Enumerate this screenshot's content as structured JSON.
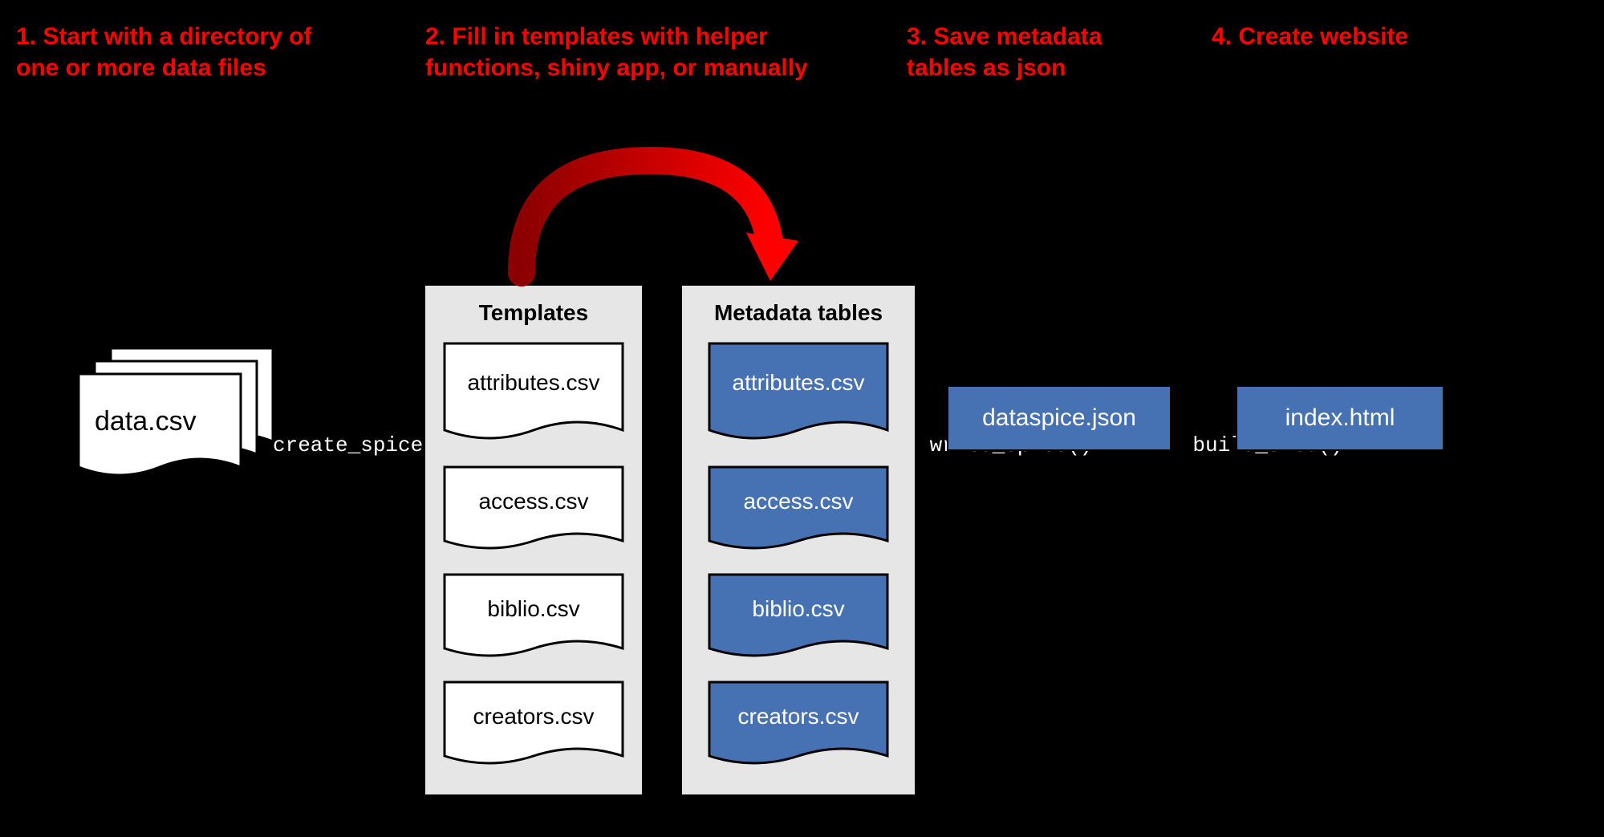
{
  "steps": {
    "s1": "1. Start with a directory of one or more data files",
    "s2": "2. Fill in templates with helper functions, shiny app, or manually",
    "s3": "3. Save metadata tables as json",
    "s4": "4. Create website"
  },
  "files": {
    "input": "data.csv",
    "templates_title": "Templates",
    "metadata_title": "Metadata tables",
    "list": {
      "attributes": "attributes.csv",
      "access": "access.csv",
      "biblio": "biblio.csv",
      "creators": "creators.csv"
    }
  },
  "captions": {
    "create_spice": "create_spice()",
    "write_spice": "write_spice()",
    "build_site": "build_site()"
  },
  "outputs": {
    "json": "dataspice.json",
    "html": "index.html"
  },
  "colors": {
    "accent_red": "#ff0000",
    "box_blue": "#4672b4",
    "panel_grey": "#e6e6e6"
  }
}
